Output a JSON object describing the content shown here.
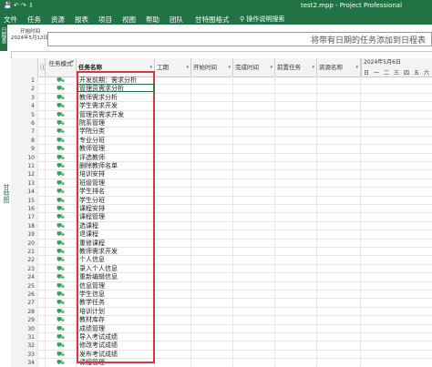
{
  "window": {
    "quick_access": "💾 ↶ ↷ ⇩",
    "title": "test2.mpp - Project Professional"
  },
  "ribbon": {
    "tabs": [
      "文件",
      "任务",
      "资源",
      "报表",
      "项目",
      "视图",
      "帮助",
      "团队",
      "甘特图格式"
    ],
    "active_tab": "甘特图格式",
    "search": "操作说明搜索"
  },
  "timeline": {
    "side_label": "日程表",
    "start_label": "开始时间",
    "start_date": "2024年5月12日",
    "message": "将带有日期的任务添加到日程表"
  },
  "view": {
    "side_label": "甘特图"
  },
  "table": {
    "columns": {
      "mode": "任务模式",
      "name": "任务名称",
      "duration": "工期",
      "start": "开始时间",
      "finish": "完成时间",
      "predecessors": "前置任务",
      "resources": "资源名称"
    },
    "timescale": {
      "week": "2024年5月6日",
      "days": [
        "日",
        "一",
        "二",
        "三",
        "四",
        "五",
        "六"
      ]
    },
    "rows": [
      {
        "id": "1",
        "name": "开发前期：需求分析"
      },
      {
        "id": "2",
        "name": "管理员需求分析"
      },
      {
        "id": "3",
        "name": "教师需求分析"
      },
      {
        "id": "4",
        "name": "学生需求开发"
      },
      {
        "id": "5",
        "name": "管理员需求开发"
      },
      {
        "id": "6",
        "name": "院系管理"
      },
      {
        "id": "7",
        "name": "学院分类"
      },
      {
        "id": "8",
        "name": "专业分班"
      },
      {
        "id": "9",
        "name": "教师管理"
      },
      {
        "id": "10",
        "name": "评选教师"
      },
      {
        "id": "11",
        "name": "删除教师名单"
      },
      {
        "id": "12",
        "name": "培训安排"
      },
      {
        "id": "13",
        "name": "班级管理"
      },
      {
        "id": "14",
        "name": "学生排名"
      },
      {
        "id": "15",
        "name": "学生分班"
      },
      {
        "id": "16",
        "name": "课程安排"
      },
      {
        "id": "17",
        "name": "课程管理"
      },
      {
        "id": "18",
        "name": "选课程"
      },
      {
        "id": "19",
        "name": "退课程"
      },
      {
        "id": "20",
        "name": "重修课程"
      },
      {
        "id": "21",
        "name": "教师需求开发"
      },
      {
        "id": "22",
        "name": "个人信息"
      },
      {
        "id": "23",
        "name": "录入个人信息"
      },
      {
        "id": "24",
        "name": "重新编辑信息"
      },
      {
        "id": "25",
        "name": "信息管理"
      },
      {
        "id": "26",
        "name": "学生信息"
      },
      {
        "id": "27",
        "name": "教学任务"
      },
      {
        "id": "28",
        "name": "培训计划"
      },
      {
        "id": "29",
        "name": "教材库存"
      },
      {
        "id": "30",
        "name": "成绩管理"
      },
      {
        "id": "31",
        "name": "导入考试成绩"
      },
      {
        "id": "32",
        "name": "修改考试成绩"
      },
      {
        "id": "33",
        "name": "发布考试成绩"
      },
      {
        "id": "34",
        "name": "课程管理"
      }
    ]
  },
  "colors": {
    "accent": "#217346",
    "selection_outline": "#d9363e"
  },
  "icons": {
    "task_mode": "auto-schedule-task-icon"
  }
}
